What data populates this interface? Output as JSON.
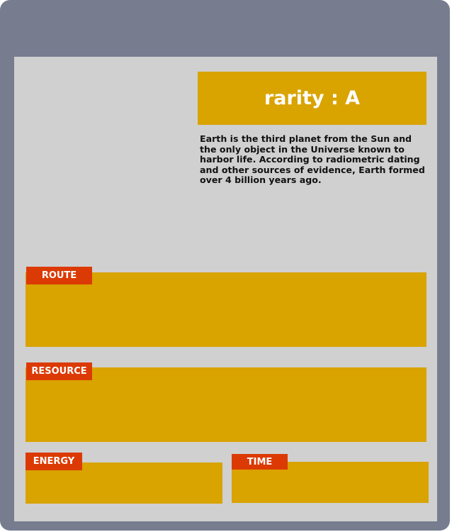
{
  "card": {
    "rarity_label": "rarity : A",
    "description": "Earth is the third planet from the Sun and\nthe only object in the Universe known to\n harbor life. According to radiometric dating\n and other sources of evidence, Earth formed\nover 4 billion years ago."
  },
  "sections": {
    "route": {
      "label": "ROUTE"
    },
    "resource": {
      "label": "RESOURCE"
    },
    "energy": {
      "label": "ENERGY"
    },
    "time": {
      "label": "TIME"
    }
  },
  "colors": {
    "frame": "#777d8f",
    "card_background": "#d0d0d0",
    "panel": "#d9a300",
    "tag": "#dc3a04"
  }
}
